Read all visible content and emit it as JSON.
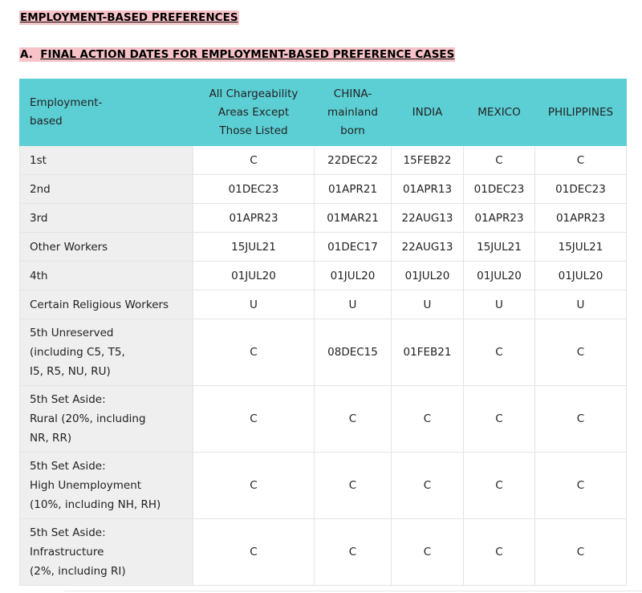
{
  "heading": "EMPLOYMENT-BASED PREFERENCES",
  "subheading": {
    "prefix": "A.",
    "title": "FINAL ACTION DATES FOR EMPLOYMENT-BASED PREFERENCE CASES"
  },
  "table": {
    "header": {
      "category": [
        "Employment-",
        "based"
      ],
      "col1": [
        "All Chargeability",
        "Areas Except",
        "Those Listed"
      ],
      "col2": [
        "CHINA-",
        "mainland",
        "born"
      ],
      "col3": "INDIA",
      "col4": "MEXICO",
      "col5": "PHILIPPINES"
    },
    "rows": [
      {
        "category": [
          "1st"
        ],
        "all": "C",
        "china": "22DEC22",
        "india": "15FEB22",
        "mexico": "C",
        "philippines": "C"
      },
      {
        "category": [
          "2nd"
        ],
        "all": "01DEC23",
        "china": "01APR21",
        "india": "01APR13",
        "mexico": "01DEC23",
        "philippines": "01DEC23"
      },
      {
        "category": [
          "3rd"
        ],
        "all": "01APR23",
        "china": "01MAR21",
        "india": "22AUG13",
        "mexico": "01APR23",
        "philippines": "01APR23"
      },
      {
        "category": [
          "Other Workers"
        ],
        "all": "15JUL21",
        "china": "01DEC17",
        "india": "22AUG13",
        "mexico": "15JUL21",
        "philippines": "15JUL21"
      },
      {
        "category": [
          "4th"
        ],
        "all": "01JUL20",
        "china": "01JUL20",
        "india": "01JUL20",
        "mexico": "01JUL20",
        "philippines": "01JUL20"
      },
      {
        "category": [
          "Certain Religious Workers"
        ],
        "all": "U",
        "china": "U",
        "india": "U",
        "mexico": "U",
        "philippines": "U"
      },
      {
        "category": [
          "5th Unreserved",
          "(including C5, T5,",
          "I5, R5, NU, RU)"
        ],
        "all": "C",
        "china": "08DEC15",
        "india": "01FEB21",
        "mexico": "C",
        "philippines": "C"
      },
      {
        "category": [
          "5th Set Aside:",
          "Rural (20%, including",
          "NR, RR)"
        ],
        "all": "C",
        "china": "C",
        "india": "C",
        "mexico": "C",
        "philippines": "C"
      },
      {
        "category": [
          "5th Set Aside:",
          "High Unemployment",
          "(10%, including NH, RH)"
        ],
        "all": "C",
        "china": "C",
        "india": "C",
        "mexico": "C",
        "philippines": "C"
      },
      {
        "category": [
          "5th Set Aside:",
          "Infrastructure",
          "(2%, including RI)"
        ],
        "all": "C",
        "china": "C",
        "india": "C",
        "mexico": "C",
        "philippines": "C"
      }
    ]
  },
  "colors": {
    "header_bg": "#5ccfd4",
    "highlight_bg": "#f7c3c8",
    "category_cell_bg": "#efefef"
  }
}
